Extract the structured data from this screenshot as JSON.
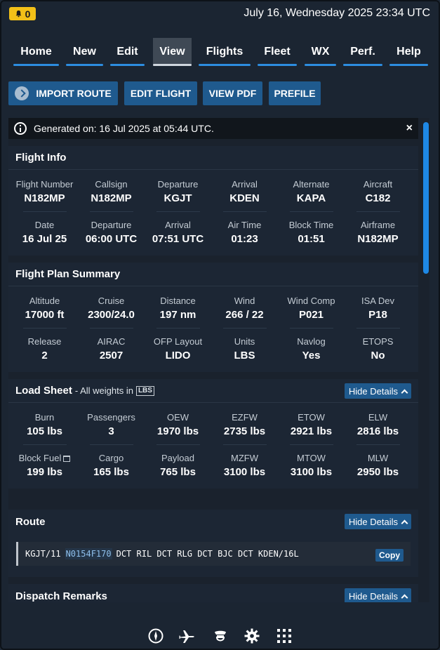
{
  "status": {
    "bell_count": "0",
    "datetime": "July 16, Wednesday 2025 23:34 UTC"
  },
  "nav": {
    "tabs": [
      "Home",
      "New",
      "Edit",
      "View",
      "Flights",
      "Fleet",
      "WX",
      "Perf.",
      "Help"
    ],
    "active": "View"
  },
  "actions": {
    "import_route": "IMPORT ROUTE",
    "edit_flight": "EDIT FLIGHT",
    "view_pdf": "VIEW PDF",
    "prefile": "PREFILE"
  },
  "notice": {
    "text": "Generated on: 16 Jul 2025 at 05:44 UTC.",
    "close": "×"
  },
  "flight_info": {
    "title": "Flight Info",
    "row1": [
      {
        "label": "Flight Number",
        "value": "N182MP"
      },
      {
        "label": "Callsign",
        "value": "N182MP"
      },
      {
        "label": "Departure",
        "value": "KGJT"
      },
      {
        "label": "Arrival",
        "value": "KDEN"
      },
      {
        "label": "Alternate",
        "value": "KAPA"
      },
      {
        "label": "Aircraft",
        "value": "C182"
      }
    ],
    "row2": [
      {
        "label": "Date",
        "value": "16 Jul 25"
      },
      {
        "label": "Departure",
        "value": "06:00 UTC"
      },
      {
        "label": "Arrival",
        "value": "07:51 UTC"
      },
      {
        "label": "Air Time",
        "value": "01:23"
      },
      {
        "label": "Block Time",
        "value": "01:51"
      },
      {
        "label": "Airframe",
        "value": "N182MP"
      }
    ]
  },
  "plan_summary": {
    "title": "Flight Plan Summary",
    "row1": [
      {
        "label": "Altitude",
        "value": "17000 ft"
      },
      {
        "label": "Cruise",
        "value": "2300/24.0"
      },
      {
        "label": "Distance",
        "value": "197 nm"
      },
      {
        "label": "Wind",
        "value": "266 / 22"
      },
      {
        "label": "Wind Comp",
        "value": "P021"
      },
      {
        "label": "ISA Dev",
        "value": "P18"
      }
    ],
    "row2": [
      {
        "label": "Release",
        "value": "2"
      },
      {
        "label": "AIRAC",
        "value": "2507"
      },
      {
        "label": "OFP Layout",
        "value": "LIDO"
      },
      {
        "label": "Units",
        "value": "LBS"
      },
      {
        "label": "Navlog",
        "value": "Yes"
      },
      {
        "label": "ETOPS",
        "value": "No"
      }
    ]
  },
  "load_sheet": {
    "title": "Load Sheet",
    "subtitle": "- All weights in",
    "unit_tag": "LBS",
    "hide_label": "Hide Details",
    "row1": [
      {
        "label": "Burn",
        "value": "105 lbs"
      },
      {
        "label": "Passengers",
        "value": "3"
      },
      {
        "label": "OEW",
        "value": "1970 lbs"
      },
      {
        "label": "EZFW",
        "value": "2735 lbs"
      },
      {
        "label": "ETOW",
        "value": "2921 lbs"
      },
      {
        "label": "ELW",
        "value": "2816 lbs"
      }
    ],
    "row2": [
      {
        "label": "Block Fuel",
        "value": "199 lbs"
      },
      {
        "label": "Cargo",
        "value": "165 lbs"
      },
      {
        "label": "Payload",
        "value": "765 lbs"
      },
      {
        "label": "MZFW",
        "value": "3100 lbs"
      },
      {
        "label": "MTOW",
        "value": "3100 lbs"
      },
      {
        "label": "MLW",
        "value": "2950 lbs"
      }
    ]
  },
  "route": {
    "title": "Route",
    "hide_label": "Hide Details",
    "start": "KGJT/11",
    "highlight": "N0154F170",
    "rest": "DCT RIL DCT RLG DCT BJC DCT KDEN/16L",
    "copy_label": "Copy"
  },
  "dispatch": {
    "title": "Dispatch Remarks",
    "hide_label": "Hide Details"
  },
  "bottom_icons": [
    "compass-icon",
    "airplane-icon",
    "pilot-icon",
    "gear-icon",
    "apps-grid-icon"
  ]
}
